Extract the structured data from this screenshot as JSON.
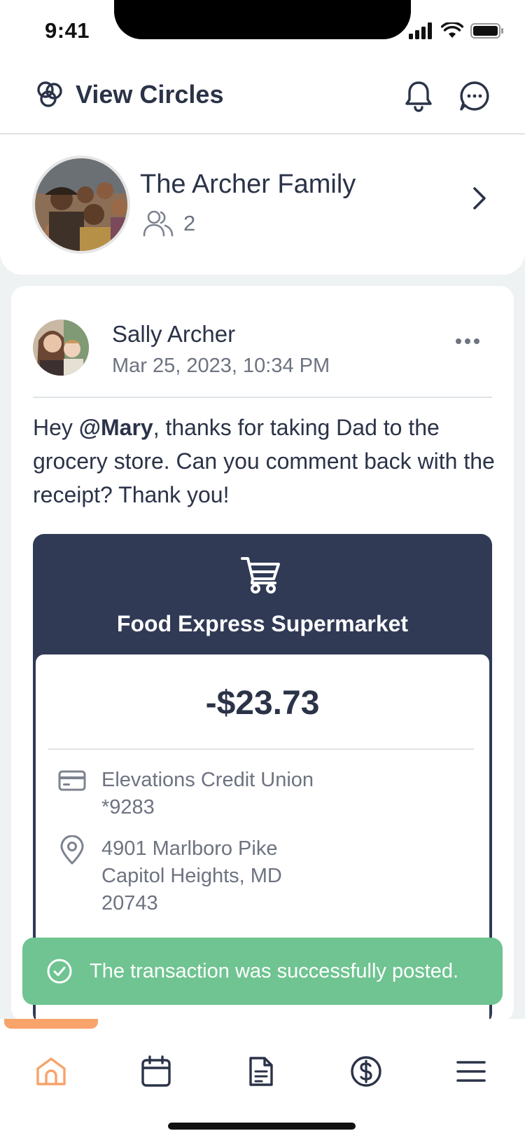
{
  "status_bar": {
    "time": "9:41"
  },
  "header": {
    "circles_label": "View Circles"
  },
  "circle": {
    "name": "The Archer Family",
    "member_count": "2"
  },
  "post": {
    "author": "Sally Archer",
    "timestamp": "Mar 25, 2023, 10:34 PM",
    "body": {
      "prefix": "Hey ",
      "mention": "@Mary",
      "suffix": ", thanks for taking Dad to the grocery store. Can you comment back with the receipt? Thank you!"
    }
  },
  "receipt": {
    "merchant": "Food Express Supermarket",
    "amount": "-$23.73",
    "account_line1": "Elevations Credit Union",
    "account_line2": "*9283",
    "address_line1": "4901 Marlboro Pike",
    "address_line2": "Capitol Heights, MD",
    "address_line3": "20743"
  },
  "toast": {
    "message": "The transaction was successfully posted."
  },
  "nav": {
    "active": "home",
    "items": [
      "home-icon",
      "calendar-icon",
      "document-icon",
      "dollar-icon",
      "menu-icon"
    ]
  },
  "colors": {
    "primary": "#303a55",
    "text": "#2b3348",
    "muted": "#6d7380",
    "accent": "#f7a36a",
    "success": "#6fc491"
  }
}
